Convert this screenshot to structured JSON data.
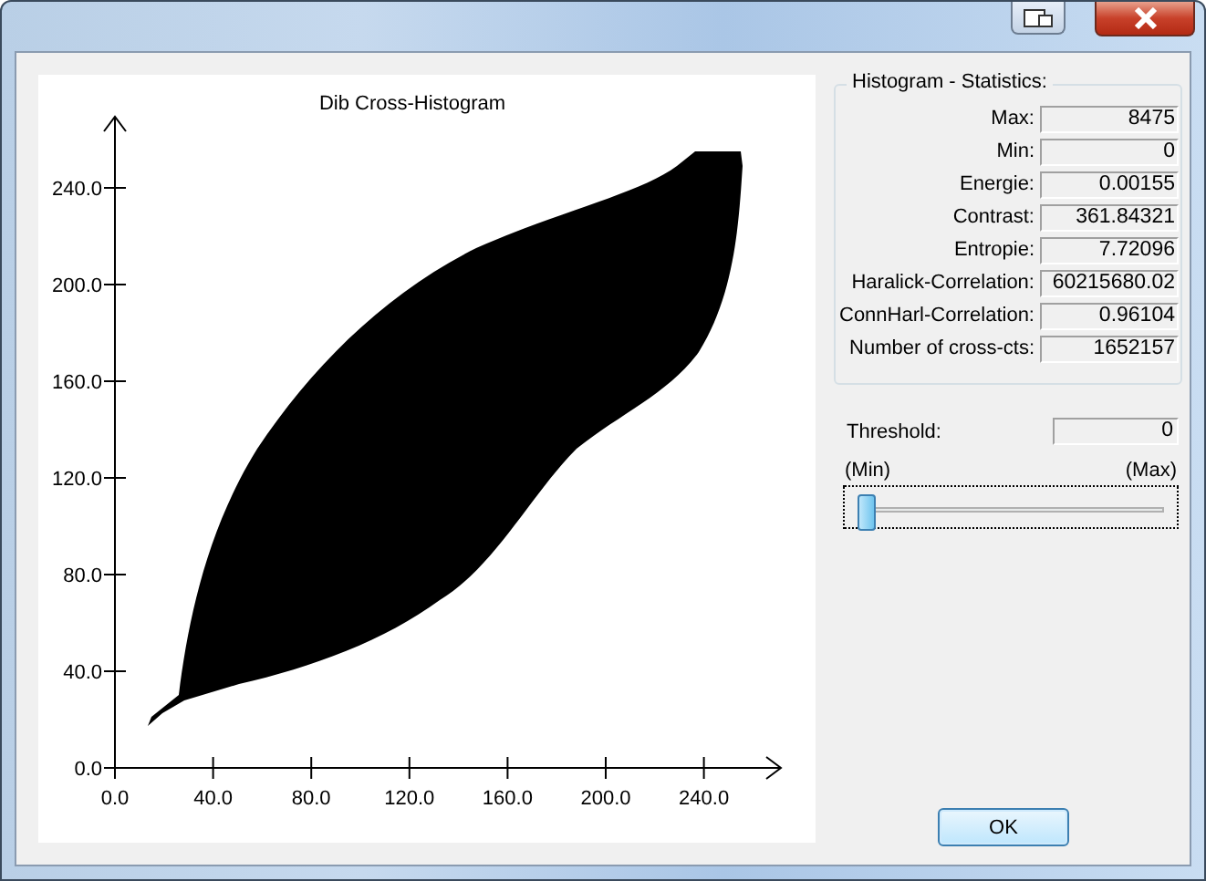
{
  "plot": {
    "title": "Dib Cross-Histogram",
    "xticks": [
      "0.0",
      "40.0",
      "80.0",
      "120.0",
      "160.0",
      "200.0",
      "240.0"
    ],
    "yticks": [
      "240.0",
      "200.0",
      "160.0",
      "120.0",
      "80.0",
      "40.0",
      "0.0"
    ]
  },
  "statistics": {
    "title": "Histogram - Statistics:",
    "rows": [
      {
        "label": "Max:",
        "value": "8475"
      },
      {
        "label": "Min:",
        "value": "0"
      },
      {
        "label": "Energie:",
        "value": "0.00155"
      },
      {
        "label": "Contrast:",
        "value": "361.84321"
      },
      {
        "label": "Entropie:",
        "value": "7.72096"
      },
      {
        "label": "Haralick-Correlation:",
        "value": "60215680.02"
      },
      {
        "label": "ConnHarl-Correlation:",
        "value": "0.96104"
      },
      {
        "label": "Number of cross-cts:",
        "value": "1652157"
      }
    ]
  },
  "threshold": {
    "label": "Threshold:",
    "value": "0",
    "min_label": "(Min)",
    "max_label": "(Max)",
    "level": 0
  },
  "buttons": [
    "OK"
  ]
}
